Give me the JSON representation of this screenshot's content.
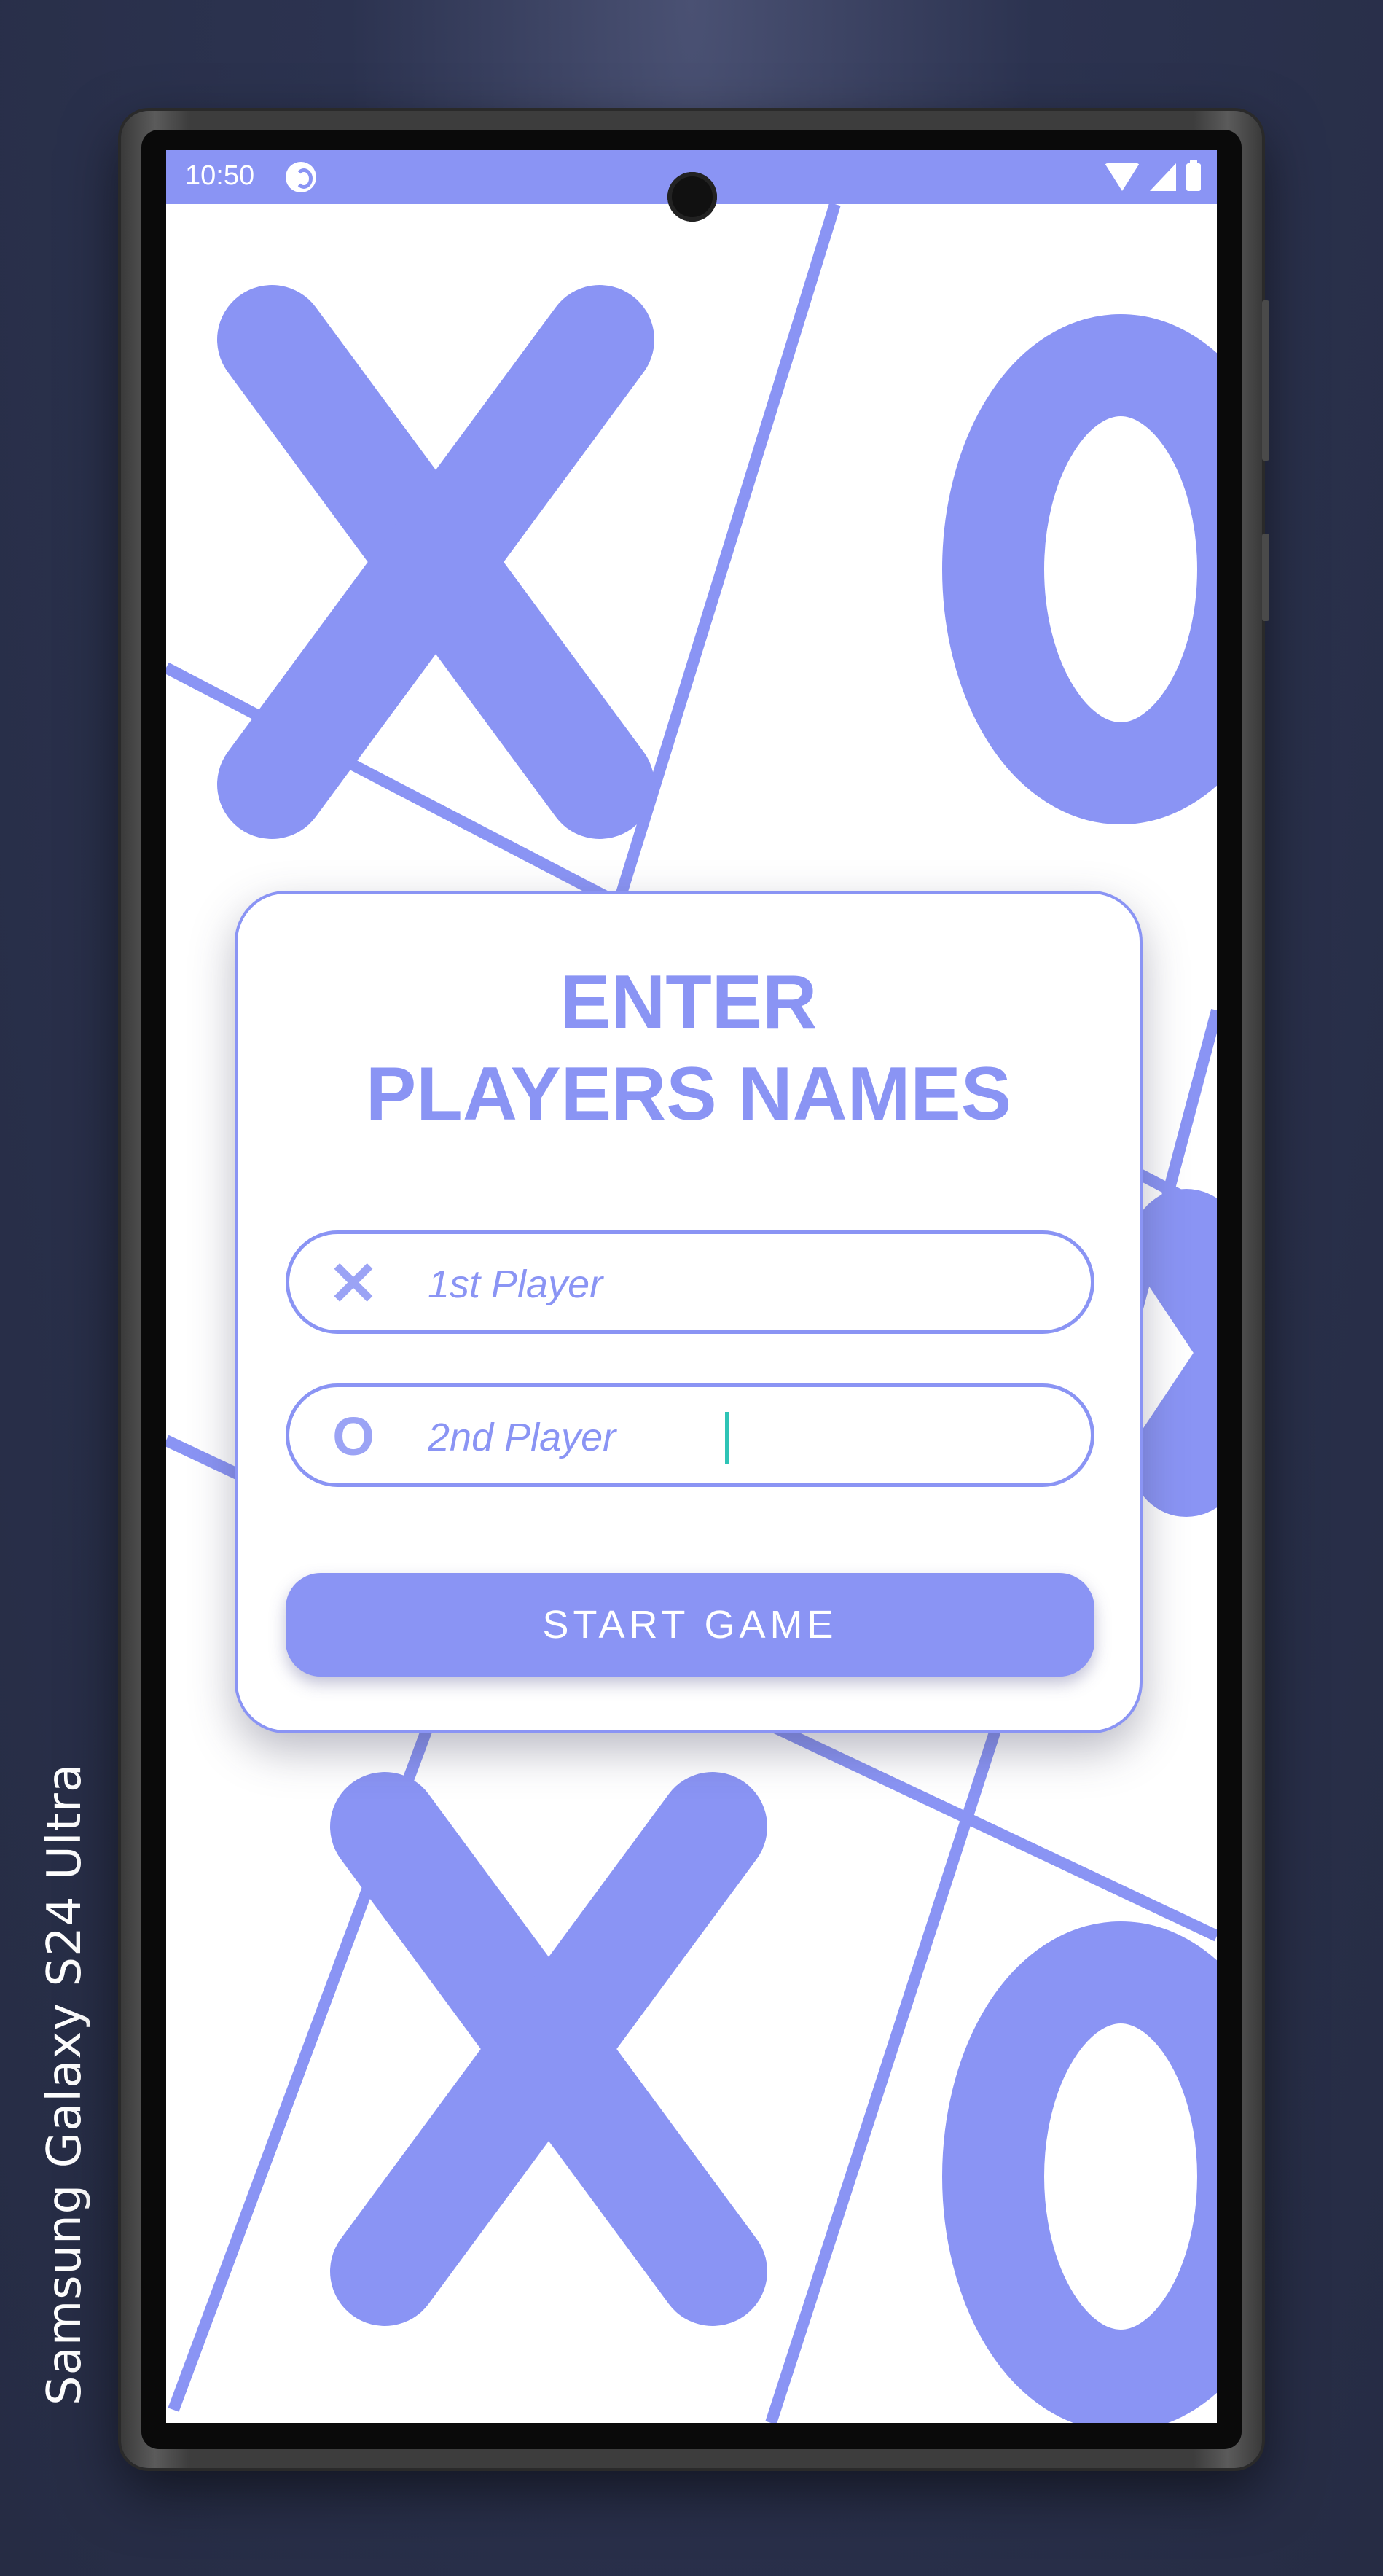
{
  "device": {
    "label": "Samsung Galaxy  S24 Ultra"
  },
  "status_bar": {
    "time": "10:50"
  },
  "dialog": {
    "title_line1": "ENTER",
    "title_line2": "PLAYERS NAMES",
    "player1": {
      "icon_glyph": "✕",
      "placeholder": "1st Player",
      "value": ""
    },
    "player2": {
      "icon_glyph": "O",
      "placeholder": "2nd Player",
      "value": ""
    },
    "start_label": "START GAME"
  },
  "colors": {
    "accent": "#8a94f4",
    "caret": "#2ec4b6",
    "background": "#ffffff"
  },
  "icons": [
    "app-indicator-icon",
    "wifi-icon",
    "signal-icon",
    "battery-icon",
    "x-mark-icon",
    "o-mark-icon"
  ]
}
